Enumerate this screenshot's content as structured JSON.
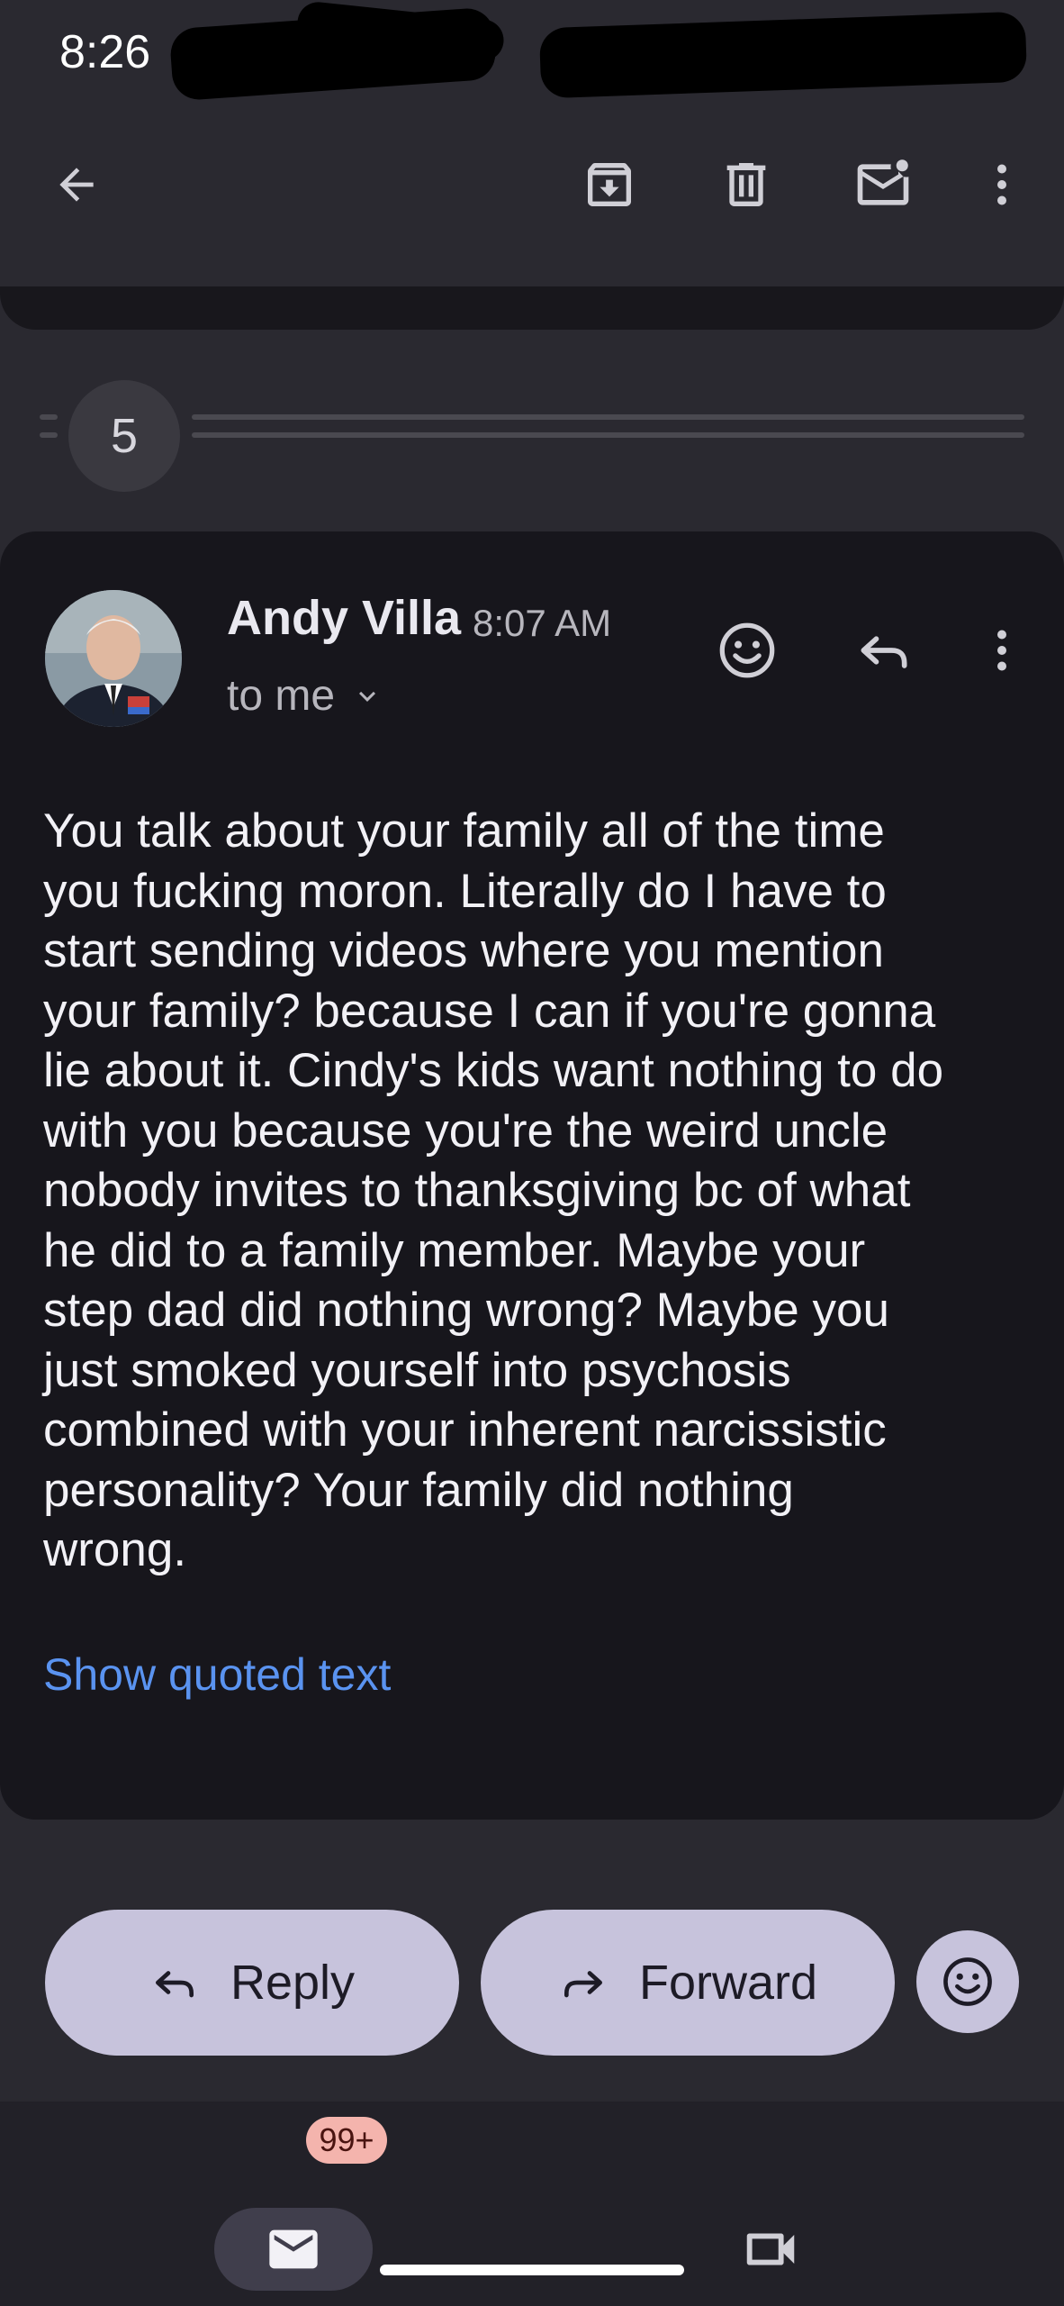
{
  "status_bar": {
    "time": "8:26"
  },
  "toolbar": {
    "back_icon": "arrow-back-icon",
    "archive_icon": "archive-icon",
    "delete_icon": "trash-icon",
    "mark_unread_icon": "mark-unread-icon",
    "more_icon": "more-vert-icon"
  },
  "thread": {
    "collapsed_count": "5"
  },
  "message": {
    "sender": "Andy Villa",
    "time": "8:07 AM",
    "recipient": "to me",
    "body_lines": [
      "You talk about your family all of the time",
      "you fucking moron. Literally do I have to",
      "start sending videos where you mention",
      "your family? because I can if you're gonna",
      "lie about it. Cindy's kids want nothing to do",
      "with you because you're the weird uncle",
      "nobody invites to thanksgiving bc of what",
      "he did to a family member. Maybe your",
      "step dad did nothing wrong? Maybe you",
      "just smoked yourself into psychosis",
      "combined with your inherent narcissistic",
      "personality? Your family did nothing",
      "wrong."
    ],
    "show_quoted": "Show quoted text"
  },
  "actions": {
    "reply_label": "Reply",
    "forward_label": "Forward"
  },
  "bottom_nav": {
    "mail_badge": "99+"
  },
  "colors": {
    "background": "#2a2930",
    "card": "#17161c",
    "pill": "#c7c3dc",
    "link": "#5a93f0",
    "badge": "#f4b4ad"
  }
}
